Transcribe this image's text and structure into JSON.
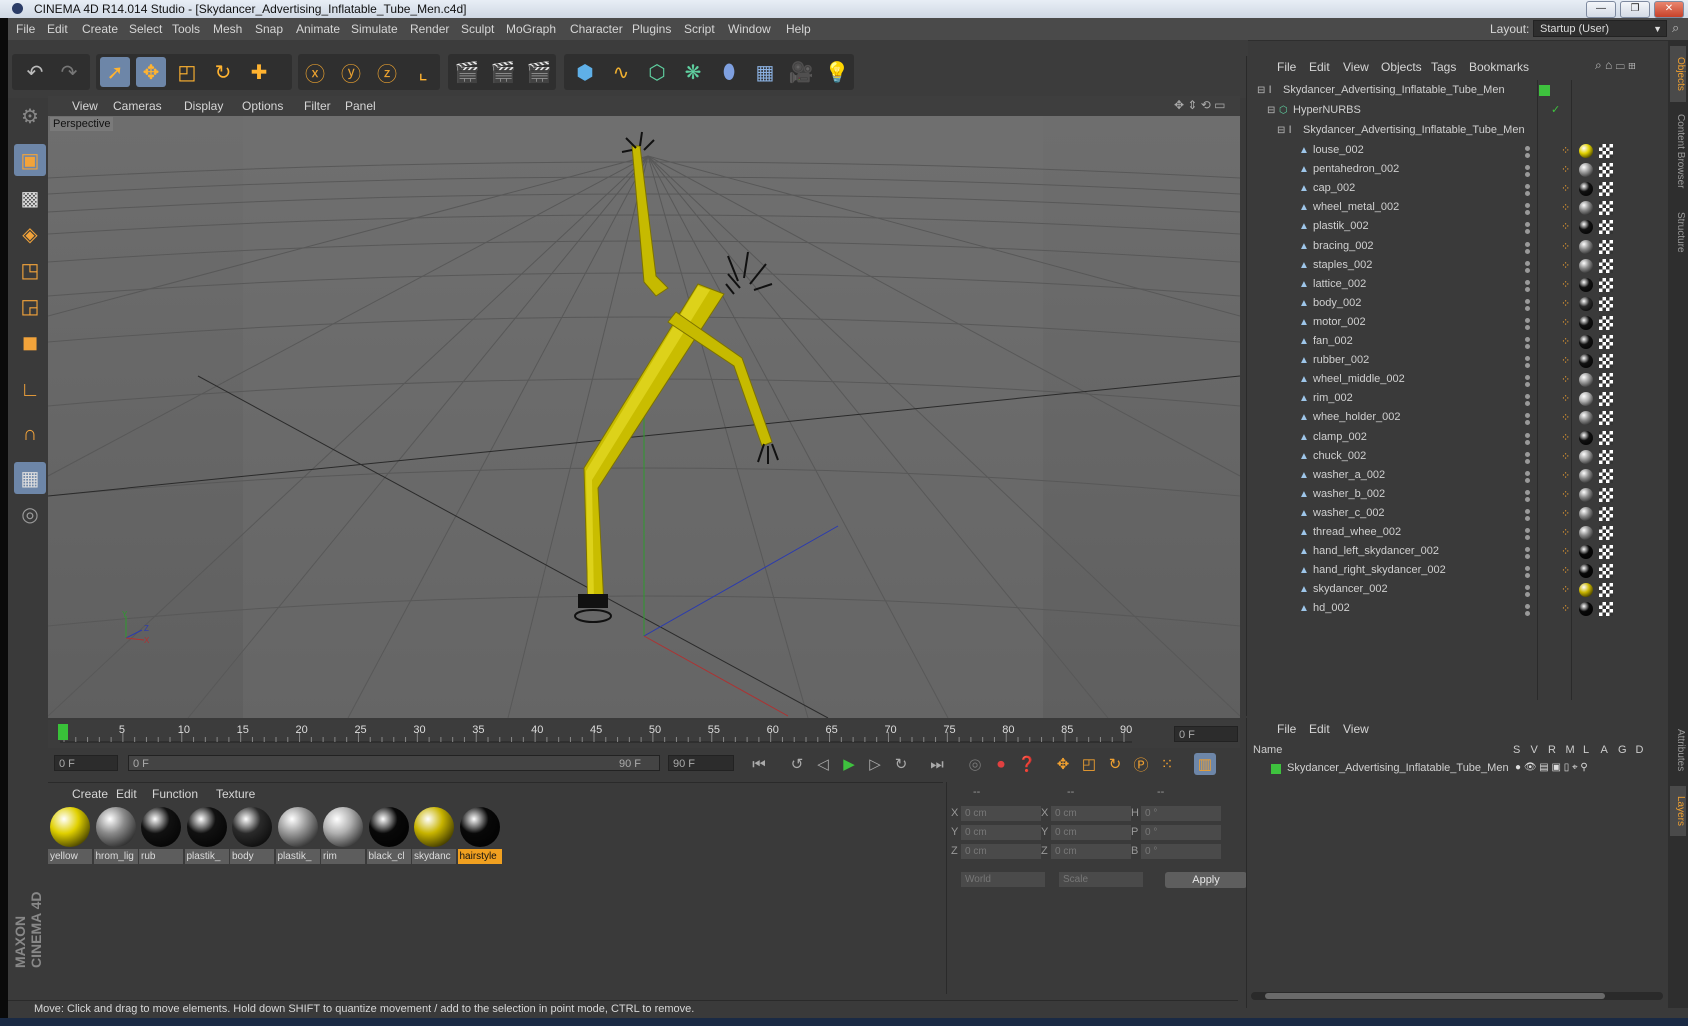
{
  "window": {
    "title": "CINEMA 4D R14.014 Studio - [Skydancer_Advertising_Inflatable_Tube_Men.c4d]",
    "minimize": "—",
    "restore": "❐",
    "close": "✕"
  },
  "menubar": {
    "items": [
      "File",
      "Edit",
      "Create",
      "Select",
      "Tools",
      "Mesh",
      "Snap",
      "Animate",
      "Simulate",
      "Render",
      "Sculpt",
      "MoGraph",
      "Character",
      "Plugins",
      "Script",
      "Window",
      "Help"
    ],
    "layout_label": "Layout:",
    "layout_value": "Startup (User)"
  },
  "viewport": {
    "menu": [
      "View",
      "Cameras",
      "Display",
      "Options",
      "Filter",
      "Panel"
    ],
    "label": "Perspective",
    "axis_y": "Y",
    "axis_z": "Z",
    "axis_x": "X"
  },
  "timeline": {
    "ticks": [
      "0",
      "5",
      "10",
      "15",
      "20",
      "25",
      "30",
      "35",
      "40",
      "45",
      "50",
      "55",
      "60",
      "65",
      "70",
      "75",
      "80",
      "85",
      "90"
    ],
    "current_frame": "0 F",
    "start_field": "0 F",
    "range_start": "0 F",
    "range_end": "90 F",
    "end_field": "90 F"
  },
  "materials": {
    "menu": [
      "Create",
      "Edit",
      "Function",
      "Texture"
    ],
    "items": [
      {
        "label": "yellow",
        "color": "#e0d000"
      },
      {
        "label": "hrom_lig",
        "color": "#8a8a8a"
      },
      {
        "label": "rub",
        "color": "#111111"
      },
      {
        "label": "plastik_",
        "color": "#111111"
      },
      {
        "label": "body",
        "color": "#2a2a2a"
      },
      {
        "label": "plastik_",
        "color": "#9a9a9a"
      },
      {
        "label": "rim",
        "color": "#b0b0b0"
      },
      {
        "label": "black_cl",
        "color": "#080808"
      },
      {
        "label": "skydanc",
        "color": "#c8b400"
      },
      {
        "label": "hairstyle",
        "color": "#080808"
      }
    ]
  },
  "coordinates": {
    "header": [
      "--",
      "--",
      "--"
    ],
    "rows": [
      {
        "a": "X",
        "av": "0 cm",
        "b": "X",
        "bv": "0 cm",
        "c": "H",
        "cv": "0 °"
      },
      {
        "a": "Y",
        "av": "0 cm",
        "b": "Y",
        "bv": "0 cm",
        "c": "P",
        "cv": "0 °"
      },
      {
        "a": "Z",
        "av": "0 cm",
        "b": "Z",
        "bv": "0 cm",
        "c": "B",
        "cv": "0 °"
      }
    ],
    "world": "World",
    "scale": "Scale",
    "apply": "Apply"
  },
  "object_manager": {
    "menu": [
      "File",
      "Edit",
      "View",
      "Objects",
      "Tags",
      "Bookmarks"
    ],
    "root": "Skydancer_Advertising_Inflatable_Tube_Men",
    "nurbs": "HyperNURBS",
    "group": "Skydancer_Advertising_Inflatable_Tube_Men",
    "objects": [
      {
        "name": "louse_002",
        "mat": "#e0d000"
      },
      {
        "name": "pentahedron_002",
        "mat": "#9a9a9a"
      },
      {
        "name": "cap_002",
        "mat": "#111111"
      },
      {
        "name": "wheel_metal_002",
        "mat": "#888888"
      },
      {
        "name": "plastik_002",
        "mat": "#111111"
      },
      {
        "name": "bracing_002",
        "mat": "#888888"
      },
      {
        "name": "staples_002",
        "mat": "#888888"
      },
      {
        "name": "lattice_002",
        "mat": "#111111"
      },
      {
        "name": "body_002",
        "mat": "#2a2a2a"
      },
      {
        "name": "motor_002",
        "mat": "#111111"
      },
      {
        "name": "fan_002",
        "mat": "#111111"
      },
      {
        "name": "rubber_002",
        "mat": "#111111"
      },
      {
        "name": "wheel_middle_002",
        "mat": "#9a9a9a"
      },
      {
        "name": "rim_002",
        "mat": "#b0b0b0"
      },
      {
        "name": "whee_holder_002",
        "mat": "#888888"
      },
      {
        "name": "clamp_002",
        "mat": "#111111"
      },
      {
        "name": "chuck_002",
        "mat": "#9a9a9a"
      },
      {
        "name": "washer_a_002",
        "mat": "#888888"
      },
      {
        "name": "washer_b_002",
        "mat": "#888888"
      },
      {
        "name": "washer_c_002",
        "mat": "#888888"
      },
      {
        "name": "thread_whee_002",
        "mat": "#888888"
      },
      {
        "name": "hand_left_skydancer_002",
        "mat": "#080808"
      },
      {
        "name": "hand_right_skydancer_002",
        "mat": "#080808"
      },
      {
        "name": "skydancer_002",
        "mat": "#c8b400"
      },
      {
        "name": "hd_002",
        "mat": "#080808"
      }
    ]
  },
  "layer_manager": {
    "menu": [
      "File",
      "Edit",
      "View"
    ],
    "col_name": "Name",
    "cols": [
      "S",
      "V",
      "R",
      "M",
      "L",
      "A",
      "G",
      "D"
    ],
    "layer": "Skydancer_Advertising_Inflatable_Tube_Men"
  },
  "right_tabs": [
    "Objects",
    "Content Browser",
    "Structure",
    "Attributes",
    "Layers"
  ],
  "status": "Move: Click and drag to move elements. Hold down SHIFT to quantize movement / add to the selection in point mode, CTRL to remove.",
  "brand": "MAXON CINEMA 4D"
}
